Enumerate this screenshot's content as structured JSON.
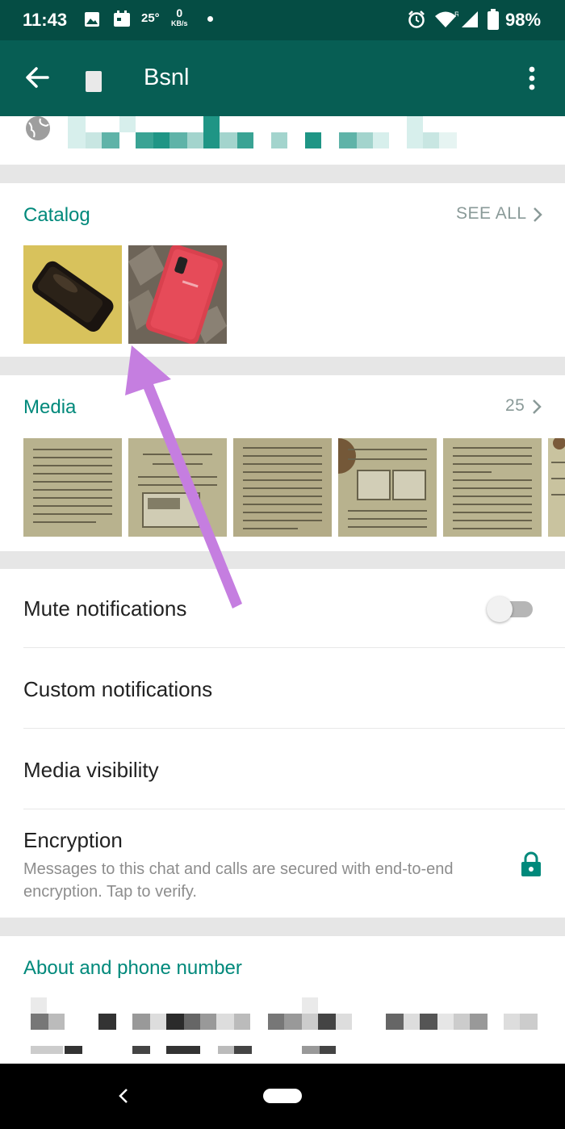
{
  "status_bar": {
    "time": "11:43",
    "temperature": "25°",
    "network_speed": "0",
    "network_unit": "KB/s",
    "battery": "98%",
    "icons": [
      "image-icon",
      "calendar-icon",
      "alarm-icon",
      "wifi-icon",
      "signal-icon",
      "battery-icon"
    ]
  },
  "app_bar": {
    "title": "Bsnl",
    "icons": [
      "back-arrow-icon",
      "more-vertical-icon"
    ]
  },
  "catalog": {
    "title": "Catalog",
    "see_all": "SEE ALL"
  },
  "media": {
    "title": "Media",
    "count": "25"
  },
  "settings": {
    "mute": "Mute notifications",
    "mute_enabled": false,
    "custom": "Custom notifications",
    "visibility": "Media visibility",
    "encryption_title": "Encryption",
    "encryption_sub": "Messages to this chat and calls are secured with end-to-end encryption. Tap to verify."
  },
  "about": {
    "title": "About and phone number"
  },
  "colors": {
    "status_bar": "#054d44",
    "app_bar": "#075e54",
    "accent": "#00897b",
    "annotation_arrow": "#c57ee0"
  }
}
